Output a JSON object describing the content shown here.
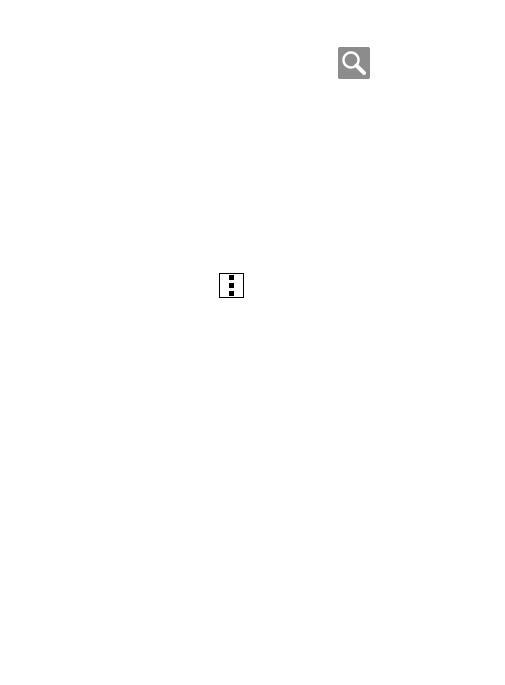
{
  "colors": {
    "background": "#ffffff",
    "search_button_fill": "#8c8c8c",
    "search_icon_stroke": "#ffffff",
    "overflow_icon_border": "#000000",
    "overflow_icon_dots": "#000000"
  },
  "toolbar": {
    "search_icon": "search-icon",
    "overflow_icon": "overflow-menu-icon"
  }
}
